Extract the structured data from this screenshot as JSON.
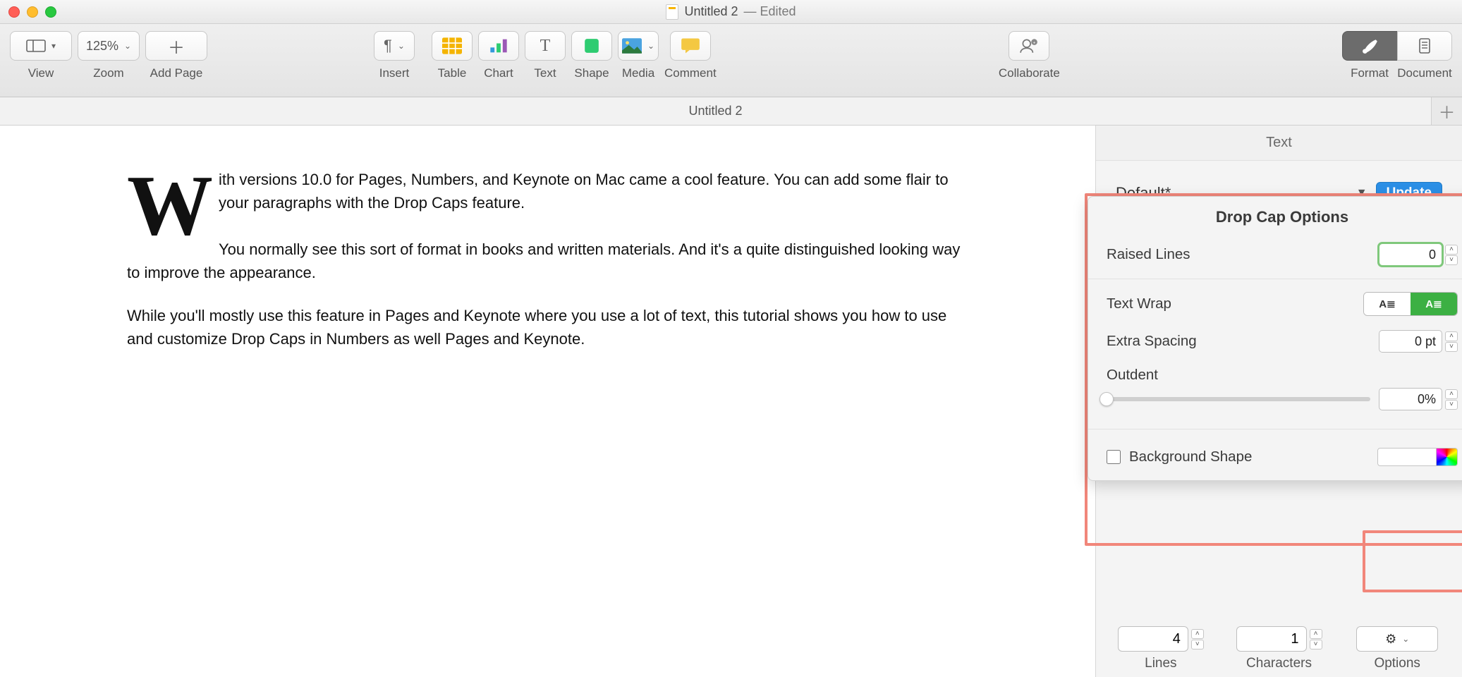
{
  "window": {
    "title_main": "Untitled 2",
    "title_suffix": " — Edited"
  },
  "toolbar": {
    "view": {
      "label": "View"
    },
    "zoom": {
      "label": "Zoom",
      "value": "125%"
    },
    "addpage": {
      "label": "Add Page"
    },
    "insert": {
      "label": "Insert"
    },
    "table": {
      "label": "Table"
    },
    "chart": {
      "label": "Chart"
    },
    "text": {
      "label": "Text"
    },
    "shape": {
      "label": "Shape"
    },
    "media": {
      "label": "Media"
    },
    "comment": {
      "label": "Comment"
    },
    "collaborate": {
      "label": "Collaborate"
    },
    "format": {
      "label": "Format"
    },
    "document": {
      "label": "Document"
    }
  },
  "tab": {
    "title": "Untitled 2"
  },
  "doc": {
    "dropcap_letter": "W",
    "p1a": "ith versions 10.0 for Pages, Numbers, and Keynote on Mac came a cool feature. You can add some flair to your paragraphs with the Drop Caps feature.",
    "p1b": "You normally see this sort of format in books and written materials. And it's a quite distinguished looking way to improve the appearance.",
    "p2": "While you'll mostly use this feature in Pages and Keynote where you use a lot of text, this tutorial shows you how to use and customize Drop Caps in Numbers as well Pages and Keynote."
  },
  "inspector": {
    "header": "Text",
    "style_name": "Default*",
    "update": "Update",
    "popover": {
      "title": "Drop Cap Options",
      "raised_lines_label": "Raised Lines",
      "raised_lines_value": "0",
      "textwrap_label": "Text Wrap",
      "textwrap_left": "A≣",
      "textwrap_right": "A≣",
      "extra_spacing_label": "Extra Spacing",
      "extra_spacing_value": "0 pt",
      "outdent_label": "Outdent",
      "outdent_value": "0%",
      "bgshape_label": "Background Shape"
    },
    "bottom": {
      "lines_value": "4",
      "lines_label": "Lines",
      "chars_value": "1",
      "chars_label": "Characters",
      "options_label": "Options"
    }
  }
}
